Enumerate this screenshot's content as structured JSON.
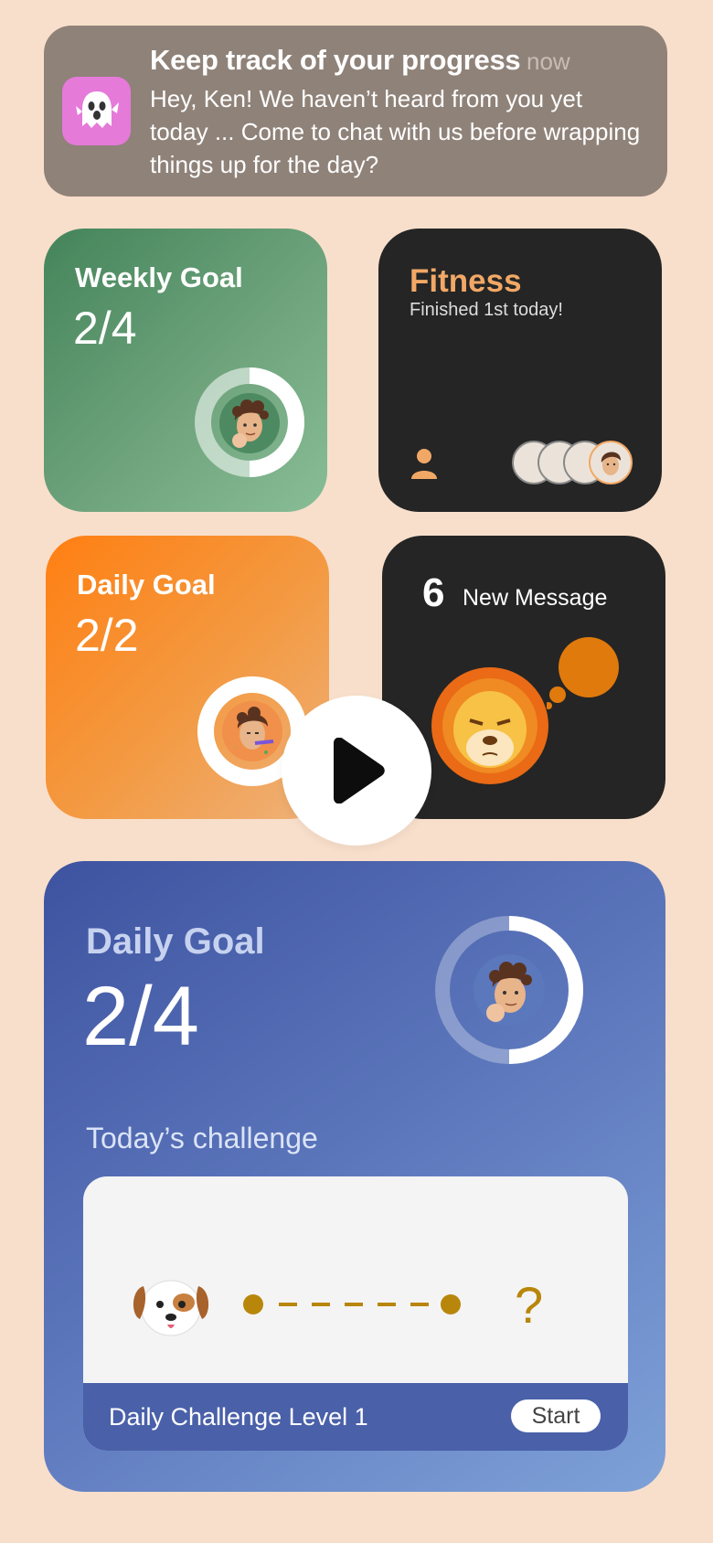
{
  "notification": {
    "title": "Keep track of your progress",
    "time": "now",
    "body": "Hey, Ken! We haven’t heard from you yet today ... Come to chat with us before wrapping things up for the day?",
    "app_icon": "ghost-icon",
    "app_color": "#e57ad9"
  },
  "weekly_goal": {
    "title": "Weekly Goal",
    "value": "2/4",
    "progress": 0.5,
    "color": "#5f9d73"
  },
  "fitness": {
    "title": "Fitness",
    "subtitle": "Finished 1st today!",
    "accent": "#f1a866",
    "icon": "person-icon"
  },
  "daily_goal_small": {
    "title": "Daily Goal",
    "value": "2/2",
    "progress": 1.0,
    "color": "#f5923a"
  },
  "messages": {
    "count": "6",
    "label": "New Message",
    "bubble_color": "#e07a0c"
  },
  "daily_goal_large": {
    "title": "Daily Goal",
    "value": "2/4",
    "progress": 0.5,
    "challenge_label": "Today’s challenge",
    "challenge_name": "Daily Challenge Level 1",
    "start_label": "Start",
    "question_mark": "?",
    "path_color": "#b8860b"
  },
  "play_button": {
    "icon": "play-icon"
  }
}
